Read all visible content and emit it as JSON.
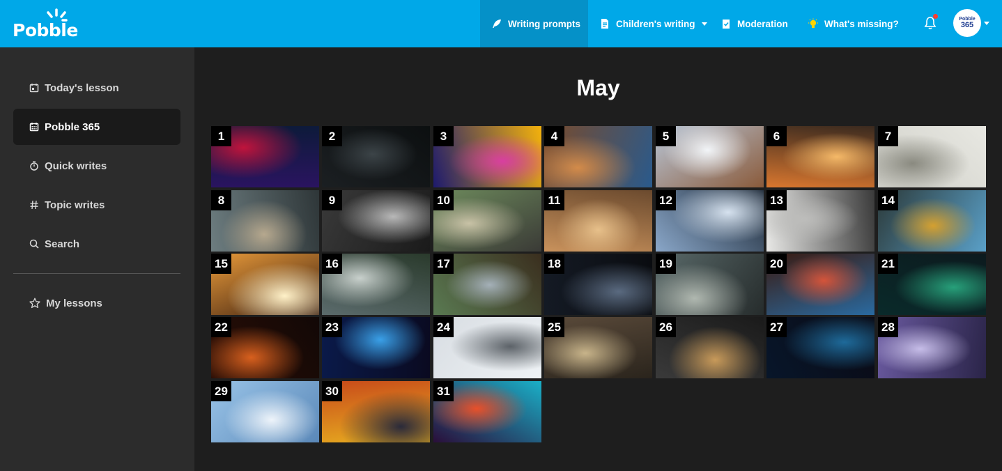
{
  "brand": {
    "logo_text": "Pobble"
  },
  "topnav": {
    "items": [
      {
        "id": "writing",
        "label": "Writing prompts",
        "icon": "feather-icon",
        "active": true,
        "dropdown": false
      },
      {
        "id": "childrens",
        "label": "Children's writing",
        "icon": "document-icon",
        "active": false,
        "dropdown": true
      },
      {
        "id": "moderation",
        "label": "Moderation",
        "icon": "clipboard-check-icon",
        "active": false,
        "dropdown": false
      },
      {
        "id": "missing",
        "label": "What's missing?",
        "icon": "lightbulb-icon",
        "active": false,
        "dropdown": false
      }
    ],
    "avatar": {
      "line1": "Pobble",
      "line2": "365"
    }
  },
  "sidebar": {
    "items": [
      {
        "label": "Today's lesson",
        "icon": "calendar-icon",
        "active": false
      },
      {
        "label": "Pobble 365",
        "icon": "calendar-grid-icon",
        "active": true
      },
      {
        "label": "Quick writes",
        "icon": "stopwatch-icon",
        "active": false
      },
      {
        "label": "Topic writes",
        "icon": "hash-icon",
        "active": false
      },
      {
        "label": "Search",
        "icon": "search-icon",
        "active": false
      }
    ],
    "secondary": [
      {
        "label": "My lessons",
        "icon": "star-icon",
        "active": false
      }
    ]
  },
  "main": {
    "month": "May",
    "days": [
      "1",
      "2",
      "3",
      "4",
      "5",
      "6",
      "7",
      "8",
      "9",
      "10",
      "11",
      "12",
      "13",
      "14",
      "15",
      "16",
      "17",
      "18",
      "19",
      "20",
      "21",
      "22",
      "23",
      "24",
      "25",
      "26",
      "27",
      "28",
      "29",
      "30",
      "31"
    ]
  },
  "colors": {
    "topbar": "#00a8e8",
    "topbar_active": "#0591c8",
    "sidebar": "#2c2c2c",
    "main_bg": "#1e1e1e",
    "notification_dot": "#ff3b30"
  }
}
